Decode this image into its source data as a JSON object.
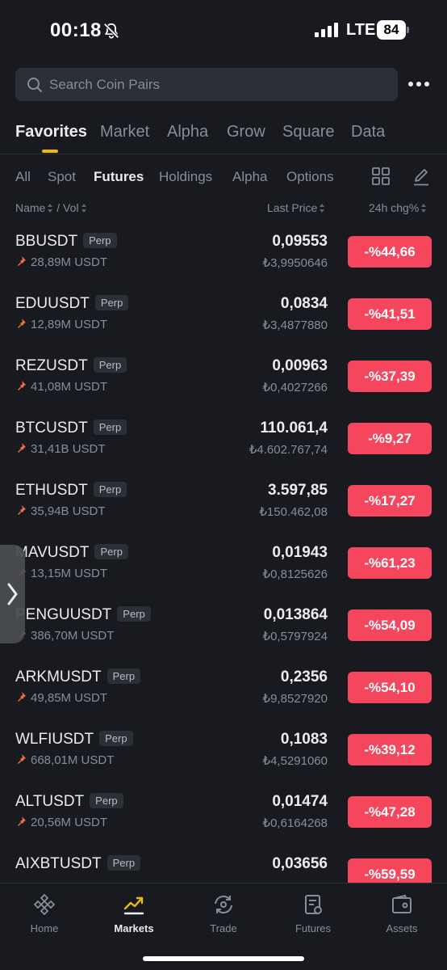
{
  "status_bar": {
    "time": "00:18",
    "network": "LTE",
    "battery": "84"
  },
  "search": {
    "placeholder": "Search Coin Pairs"
  },
  "main_tabs": [
    {
      "label": "Favorites",
      "active": true
    },
    {
      "label": "Market"
    },
    {
      "label": "Alpha"
    },
    {
      "label": "Grow"
    },
    {
      "label": "Square"
    },
    {
      "label": "Data"
    }
  ],
  "sub_tabs": [
    {
      "label": "All"
    },
    {
      "label": "Spot"
    },
    {
      "label": "Futures",
      "active": true
    },
    {
      "label": "Holdings"
    },
    {
      "label": "Alpha"
    },
    {
      "label": "Options"
    }
  ],
  "columns": {
    "name": "Name",
    "vol": "/ Vol",
    "last_price": "Last Price",
    "change": "24h chg%"
  },
  "tag": "Perp",
  "colors": {
    "accent": "#f0b90b",
    "negative": "#f6465d",
    "background": "#181a20",
    "pin": "#f26b3a"
  },
  "rows": [
    {
      "pair": "BBUSDT",
      "tag": "Perp",
      "vol": "28,89M USDT",
      "price": "0,09553",
      "fiat": "₺3,9950646",
      "change": "-%44,66"
    },
    {
      "pair": "EDUUSDT",
      "tag": "Perp",
      "vol": "12,89M USDT",
      "price": "0,0834",
      "fiat": "₺3,4877880",
      "change": "-%41,51"
    },
    {
      "pair": "REZUSDT",
      "tag": "Perp",
      "vol": "41,08M USDT",
      "price": "0,00963",
      "fiat": "₺0,4027266",
      "change": "-%37,39"
    },
    {
      "pair": "BTCUSDT",
      "tag": "Perp",
      "vol": "31,41B USDT",
      "price": "110.061,4",
      "fiat": "₺4.602.767,74",
      "change": "-%9,27"
    },
    {
      "pair": "ETHUSDT",
      "tag": "Perp",
      "vol": "35,94B USDT",
      "price": "3.597,85",
      "fiat": "₺150.462,08",
      "change": "-%17,27"
    },
    {
      "pair": "MAVUSDT",
      "tag": "Perp",
      "vol": "13,15M USDT",
      "price": "0,01943",
      "fiat": "₺0,8125626",
      "change": "-%61,23"
    },
    {
      "pair": "PENGUUSDT",
      "tag": "Perp",
      "vol": "386,70M USDT",
      "price": "0,013864",
      "fiat": "₺0,5797924",
      "change": "-%54,09"
    },
    {
      "pair": "ARKMUSDT",
      "tag": "Perp",
      "vol": "49,85M USDT",
      "price": "0,2356",
      "fiat": "₺9,8527920",
      "change": "-%54,10"
    },
    {
      "pair": "WLFIUSDT",
      "tag": "Perp",
      "vol": "668,01M USDT",
      "price": "0,1083",
      "fiat": "₺4,5291060",
      "change": "-%39,12"
    },
    {
      "pair": "ALTUSDT",
      "tag": "Perp",
      "vol": "20,56M USDT",
      "price": "0,01474",
      "fiat": "₺0,6164268",
      "change": "-%47,28"
    },
    {
      "pair": "AIXBTUSDT",
      "tag": "Perp",
      "vol": "",
      "price": "0,03656",
      "fiat": "",
      "change": "-%59,59"
    }
  ],
  "bottom_nav": [
    {
      "label": "Home",
      "icon": "home-icon"
    },
    {
      "label": "Markets",
      "icon": "markets-icon",
      "active": true
    },
    {
      "label": "Trade",
      "icon": "trade-icon"
    },
    {
      "label": "Futures",
      "icon": "futures-icon"
    },
    {
      "label": "Assets",
      "icon": "assets-icon"
    }
  ]
}
